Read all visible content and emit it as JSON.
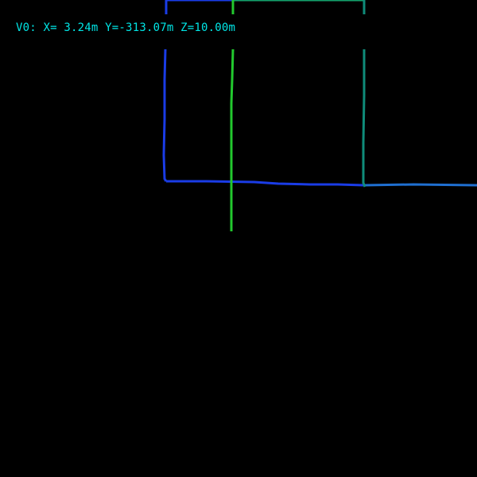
{
  "hud": {
    "readout": "V0: X= 3.24m Y=-313.07m Z=10.00m",
    "color": "#00E5E5"
  },
  "path_colors": {
    "blue": "#1A3CE6",
    "green": "#22C92E",
    "teal": "#0F8C7A",
    "mid_blue": "#1F6FD0",
    "top_green": "#13A06C"
  }
}
